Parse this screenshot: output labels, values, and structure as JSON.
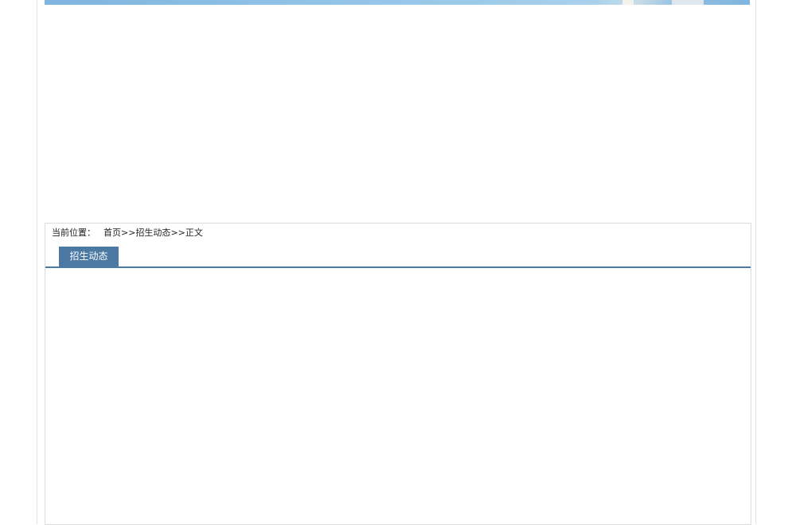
{
  "breadcrumb": {
    "label": "当前位置：",
    "home": "首页",
    "sep1": ">>",
    "section": "招生动态",
    "sep2": ">>",
    "current": "正文"
  },
  "tabs": {
    "active_label": "招生动态"
  },
  "colors": {
    "tab_active_bg": "#4b79a4",
    "tab_underline": "#4e7ba6",
    "banner_sky": "#8cc0e6"
  }
}
